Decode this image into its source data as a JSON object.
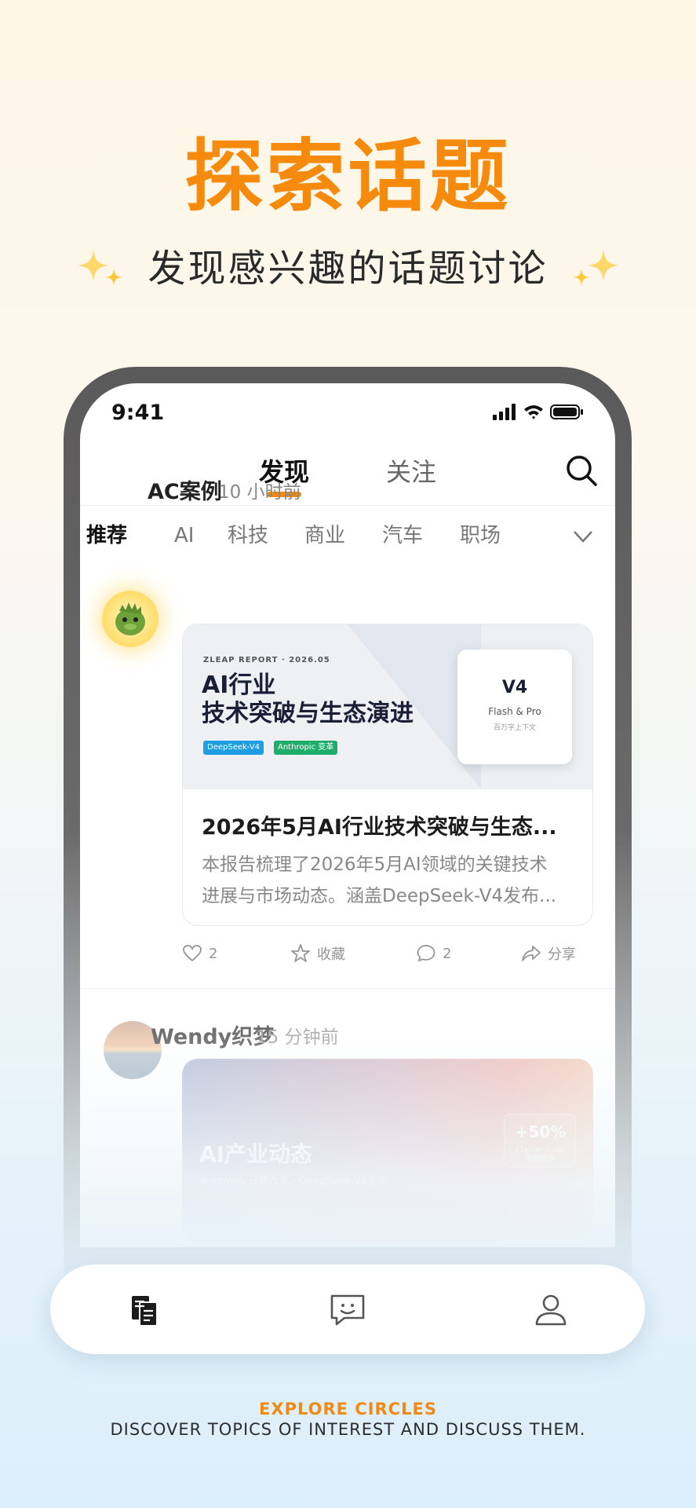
{
  "hero": {
    "title": "探索话题",
    "subtitle": "发现感兴趣的话题讨论"
  },
  "status_bar": {
    "time": "9:41"
  },
  "header": {
    "tabs": [
      {
        "label": "发现",
        "active": true
      },
      {
        "label": "关注",
        "active": false
      }
    ],
    "search_icon": "search-icon"
  },
  "categories": {
    "items": [
      "推荐",
      "AI",
      "科技",
      "商业",
      "汽车",
      "职场"
    ],
    "active": "推荐",
    "more_icon": "chevron-down-icon"
  },
  "posts": [
    {
      "author": "AC案例",
      "time": "10 小时前",
      "cover": {
        "kicker": "ZLEAP REPORT · 2026.05",
        "title_line1": "AI行业",
        "title_line2": "技术突破与生态演进",
        "tags": [
          "DeepSeek-V4",
          "Anthropic 变革"
        ],
        "box_title": "V4",
        "box_sub": "Flash & Pro",
        "box_sub2": "百万字上下文"
      },
      "title": "2026年5月AI行业技术突破与生态...",
      "body_line1": "本报告梳理了2026年5月AI领域的关键技术",
      "body_line2": "进展与市场动态。涵盖DeepSeek-V4发布...",
      "actions": {
        "likes": "2",
        "favorite_label": "收藏",
        "comments": "2",
        "share_label": "分享"
      }
    },
    {
      "author": "Wendy织梦",
      "time": "15 分钟前",
      "cover": {
        "title": "AI产业动态",
        "subtitle": "Anthropic计费改革 · DeepSeek V4发布",
        "box_value": "+50%",
        "box_sub1": "Claude Code",
        "box_sub2": "限额提升"
      }
    }
  ],
  "bottom_nav": {
    "items": [
      {
        "icon": "feed-icon",
        "active": true
      },
      {
        "icon": "message-icon",
        "active": false
      },
      {
        "icon": "profile-icon",
        "active": false
      }
    ]
  },
  "footer": {
    "title": "EXPLORE CIRCLES",
    "subtitle": "DISCOVER TOPICS OF INTEREST AND DISCUSS THEM."
  },
  "colors": {
    "accent": "#f58a0c",
    "text_dark": "#1c1c1c",
    "text_muted": "#888888"
  }
}
